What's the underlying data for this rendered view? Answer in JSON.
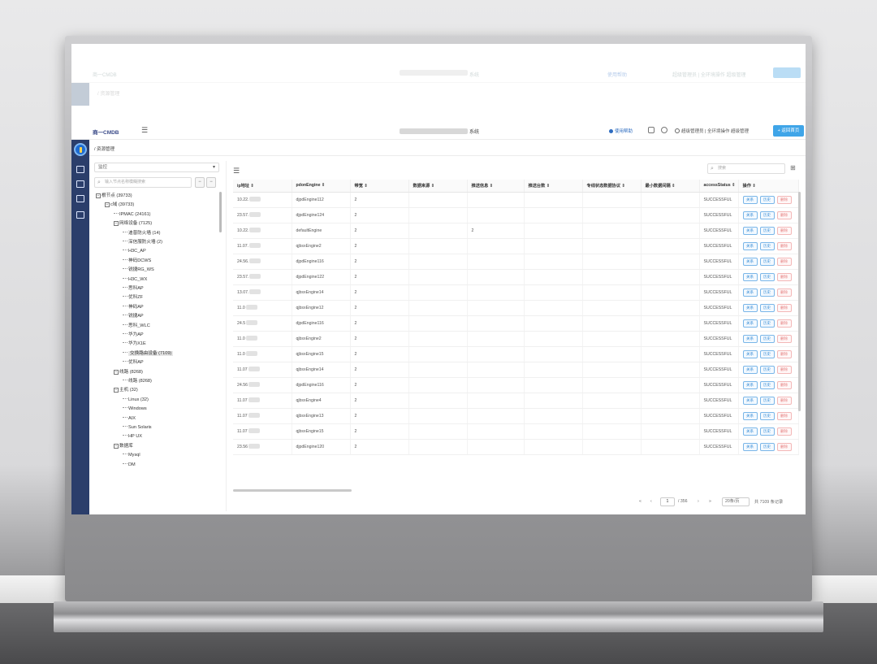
{
  "app": {
    "logo": "商一CMDB",
    "system_title_suffix": "系统",
    "help_link": "使用帮助",
    "user_text": "超级管理员 | 全环境操作 超级管理",
    "return_button": "+ 返回首页",
    "breadcrumb": "/ 资源管理"
  },
  "ghost": {
    "logo": "商一CMDB",
    "suffix": "系统",
    "help": "使用帮助",
    "user": "超级管理员 | 全环境操作 超级管理",
    "button": "+ 返回首页",
    "crumb": "/ 资源管理"
  },
  "tree": {
    "select_value": "监控",
    "search_placeholder": "输入节点名称模糊搜索",
    "nodes": [
      {
        "label": "根节点 (39733)",
        "level": 0,
        "expand": "−"
      },
      {
        "label": "c域 (39733)",
        "level": 1,
        "expand": "−"
      },
      {
        "label": "IPMAC (24161)",
        "level": 2,
        "expand": ""
      },
      {
        "label": "网络设备 (7125)",
        "level": 2,
        "expand": "−"
      },
      {
        "label": "迪普防火墙 (14)",
        "level": 3,
        "expand": ""
      },
      {
        "label": "深信服防火墙 (2)",
        "level": 3,
        "expand": ""
      },
      {
        "label": "H3C_AP",
        "level": 3,
        "expand": ""
      },
      {
        "label": "神码DCWS",
        "level": 3,
        "expand": ""
      },
      {
        "label": "锐捷RG_WS",
        "level": 3,
        "expand": ""
      },
      {
        "label": "H3C_WX",
        "level": 3,
        "expand": ""
      },
      {
        "label": "思科AP",
        "level": 3,
        "expand": ""
      },
      {
        "label": "优科ZF",
        "level": 3,
        "expand": ""
      },
      {
        "label": "神码AP",
        "level": 3,
        "expand": ""
      },
      {
        "label": "锐捷AP",
        "level": 3,
        "expand": ""
      },
      {
        "label": "思科_WLC",
        "level": 3,
        "expand": ""
      },
      {
        "label": "华为AP",
        "level": 3,
        "expand": ""
      },
      {
        "label": "华为X1E",
        "level": 3,
        "expand": ""
      },
      {
        "label": "交换路由设备 (7109)",
        "level": 3,
        "expand": "",
        "selected": true
      },
      {
        "label": "优科AP",
        "level": 3,
        "expand": ""
      },
      {
        "label": "线路 (8268)",
        "level": 2,
        "expand": "−"
      },
      {
        "label": "线路 (8268)",
        "level": 3,
        "expand": ""
      },
      {
        "label": "主机 (32)",
        "level": 2,
        "expand": "−"
      },
      {
        "label": "Linux (32)",
        "level": 3,
        "expand": ""
      },
      {
        "label": "Windows",
        "level": 3,
        "expand": ""
      },
      {
        "label": "AIX",
        "level": 3,
        "expand": ""
      },
      {
        "label": "Sun Solaris",
        "level": 3,
        "expand": ""
      },
      {
        "label": "HP UX",
        "level": 3,
        "expand": ""
      },
      {
        "label": "数据库",
        "level": 2,
        "expand": "−"
      },
      {
        "label": "Mysql",
        "level": 3,
        "expand": ""
      },
      {
        "label": "DM",
        "level": 3,
        "expand": ""
      }
    ]
  },
  "table": {
    "search_placeholder": "搜索",
    "columns": [
      "ip地址 ⇕",
      "pdonEngine ⇕",
      "带宽 ⇕",
      "数据来源 ⇕",
      "推送信息 ⇕",
      "推送台数 ⇕",
      "专线状态数据协议 ⇕",
      "最小数据间隔 ⇕",
      "accessStatus ⇕",
      "操作 ⇕"
    ],
    "op_labels": {
      "edit": "关系",
      "history": "历史",
      "delete": "删除"
    },
    "rows": [
      {
        "ip": "10.22.",
        "engine": "djpdEngine112",
        "bw": "2",
        "push": "",
        "status": "SUCCESSFUL"
      },
      {
        "ip": "23.57.",
        "engine": "djpdEngine124",
        "bw": "2",
        "push": "",
        "status": "SUCCESSFUL"
      },
      {
        "ip": "10.22.",
        "engine": "defaultEngine",
        "bw": "2",
        "push": "2",
        "status": "SUCCESSFUL"
      },
      {
        "ip": "11.07.",
        "engine": "qjbsxEngine2",
        "bw": "2",
        "push": "",
        "status": "SUCCESSFUL"
      },
      {
        "ip": "24.56.",
        "engine": "djpdEngine116",
        "bw": "2",
        "push": "",
        "status": "SUCCESSFUL"
      },
      {
        "ip": "23.57.",
        "engine": "djpdEngine122",
        "bw": "2",
        "push": "",
        "status": "SUCCESSFUL"
      },
      {
        "ip": "13.07.",
        "engine": "qjbsxEngine14",
        "bw": "2",
        "push": "",
        "status": "SUCCESSFUL"
      },
      {
        "ip": "11.0",
        "engine": "qjbsxEngine12",
        "bw": "2",
        "push": "",
        "status": "SUCCESSFUL"
      },
      {
        "ip": "24.5",
        "engine": "djpdEngine116",
        "bw": "2",
        "push": "",
        "status": "SUCCESSFUL"
      },
      {
        "ip": "11.0",
        "engine": "qjbsxEngine2",
        "bw": "2",
        "push": "",
        "status": "SUCCESSFUL"
      },
      {
        "ip": "11.0",
        "engine": "qjbsxEngine15",
        "bw": "2",
        "push": "",
        "status": "SUCCESSFUL"
      },
      {
        "ip": "11.07",
        "engine": "qjbsxEngine14",
        "bw": "2",
        "push": "",
        "status": "SUCCESSFUL"
      },
      {
        "ip": "24.56",
        "engine": "djpdEngine116",
        "bw": "2",
        "push": "",
        "status": "SUCCESSFUL"
      },
      {
        "ip": "11.07",
        "engine": "qjbsxEngine4",
        "bw": "2",
        "push": "",
        "status": "SUCCESSFUL"
      },
      {
        "ip": "11.07",
        "engine": "qjbsxEngine13",
        "bw": "2",
        "push": "",
        "status": "SUCCESSFUL"
      },
      {
        "ip": "11.07",
        "engine": "qjbsxEngine15",
        "bw": "2",
        "push": "",
        "status": "SUCCESSFUL"
      },
      {
        "ip": "23.56",
        "engine": "djpdEngine120",
        "bw": "2",
        "push": "",
        "status": "SUCCESSFUL"
      }
    ]
  },
  "pager": {
    "prev_first": "«",
    "prev": "‹",
    "page": "1",
    "total_pages": "/ 356",
    "next": "›",
    "next_last": "»",
    "page_size": "20条/页",
    "total": "共 7109 条记录"
  },
  "colors": {
    "nav_bg": "#2b3e6b",
    "accent": "#3fa5e8",
    "success_text": "#555555"
  },
  "icons": [
    "menu-icon",
    "help-icon",
    "message-icon",
    "clock-icon",
    "user-icon",
    "search-icon",
    "grid-icon",
    "cube-icon",
    "network-icon",
    "monitor-icon",
    "server-icon"
  ]
}
